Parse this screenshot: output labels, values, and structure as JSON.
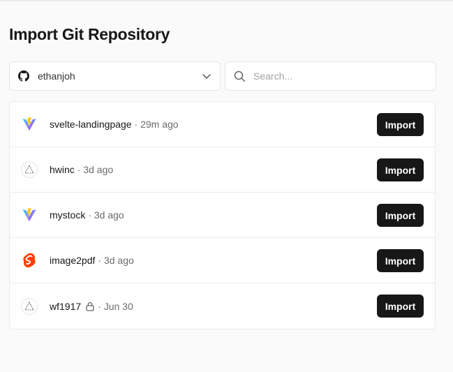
{
  "page": {
    "title": "Import Git Repository"
  },
  "account_select": {
    "value": "ethanjoh",
    "icon": "github-icon"
  },
  "search": {
    "placeholder": "Search..."
  },
  "import_label": "Import",
  "repos": [
    {
      "name": "svelte-landingpage",
      "time": "· 29m ago",
      "icon": "vite-icon",
      "private": false
    },
    {
      "name": "hwinc",
      "time": "· 3d ago",
      "icon": "framework-placeholder-icon",
      "private": false
    },
    {
      "name": "mystock",
      "time": "· 3d ago",
      "icon": "vite-icon",
      "private": false
    },
    {
      "name": "image2pdf",
      "time": "· 3d ago",
      "icon": "svelte-icon",
      "private": false
    },
    {
      "name": "wf1917",
      "time": "· Jun 30",
      "icon": "framework-placeholder-icon",
      "private": true
    }
  ],
  "colors": {
    "button_bg": "#171717",
    "svelte": "#ff3e00",
    "vite_purple": "#8f57ff",
    "vite_yellow": "#ffc517"
  }
}
